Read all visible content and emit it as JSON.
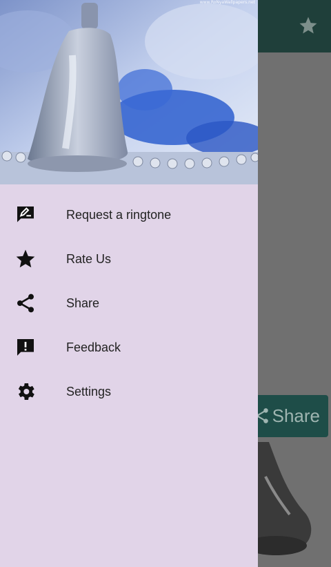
{
  "app": {
    "share_button_label": "Share",
    "header_watermark": "www.RoNyaWallpapers.net"
  },
  "drawer": {
    "items": [
      {
        "label": "Request a ringtone",
        "icon": "request-ringtone-icon"
      },
      {
        "label": "Rate Us",
        "icon": "star-icon"
      },
      {
        "label": "Share",
        "icon": "share-icon"
      },
      {
        "label": "Feedback",
        "icon": "feedback-icon"
      },
      {
        "label": "Settings",
        "icon": "gear-icon"
      }
    ]
  },
  "colors": {
    "drawer_background": "#e1d4e8",
    "app_bar": "#1f3f3a",
    "share_button": "#1e4d48",
    "scrim": "#6b6b6b"
  }
}
